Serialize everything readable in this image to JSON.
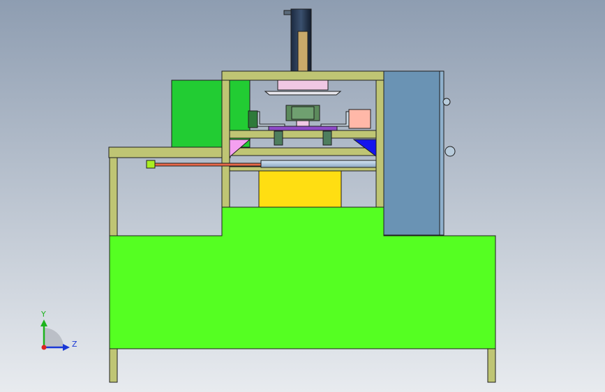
{
  "triad": {
    "y_label": "Y",
    "z_label": "Z"
  },
  "colors": {
    "frame": "#BFC574",
    "body_green": "#55FF22",
    "side_green": "#22CC33",
    "panel_blue": "#6A93B4",
    "yellow_block": "#FFDE12",
    "pink_gusset": "#F4A0F0",
    "blue_gusset": "#1414EE",
    "cylinder": "#16243A"
  }
}
